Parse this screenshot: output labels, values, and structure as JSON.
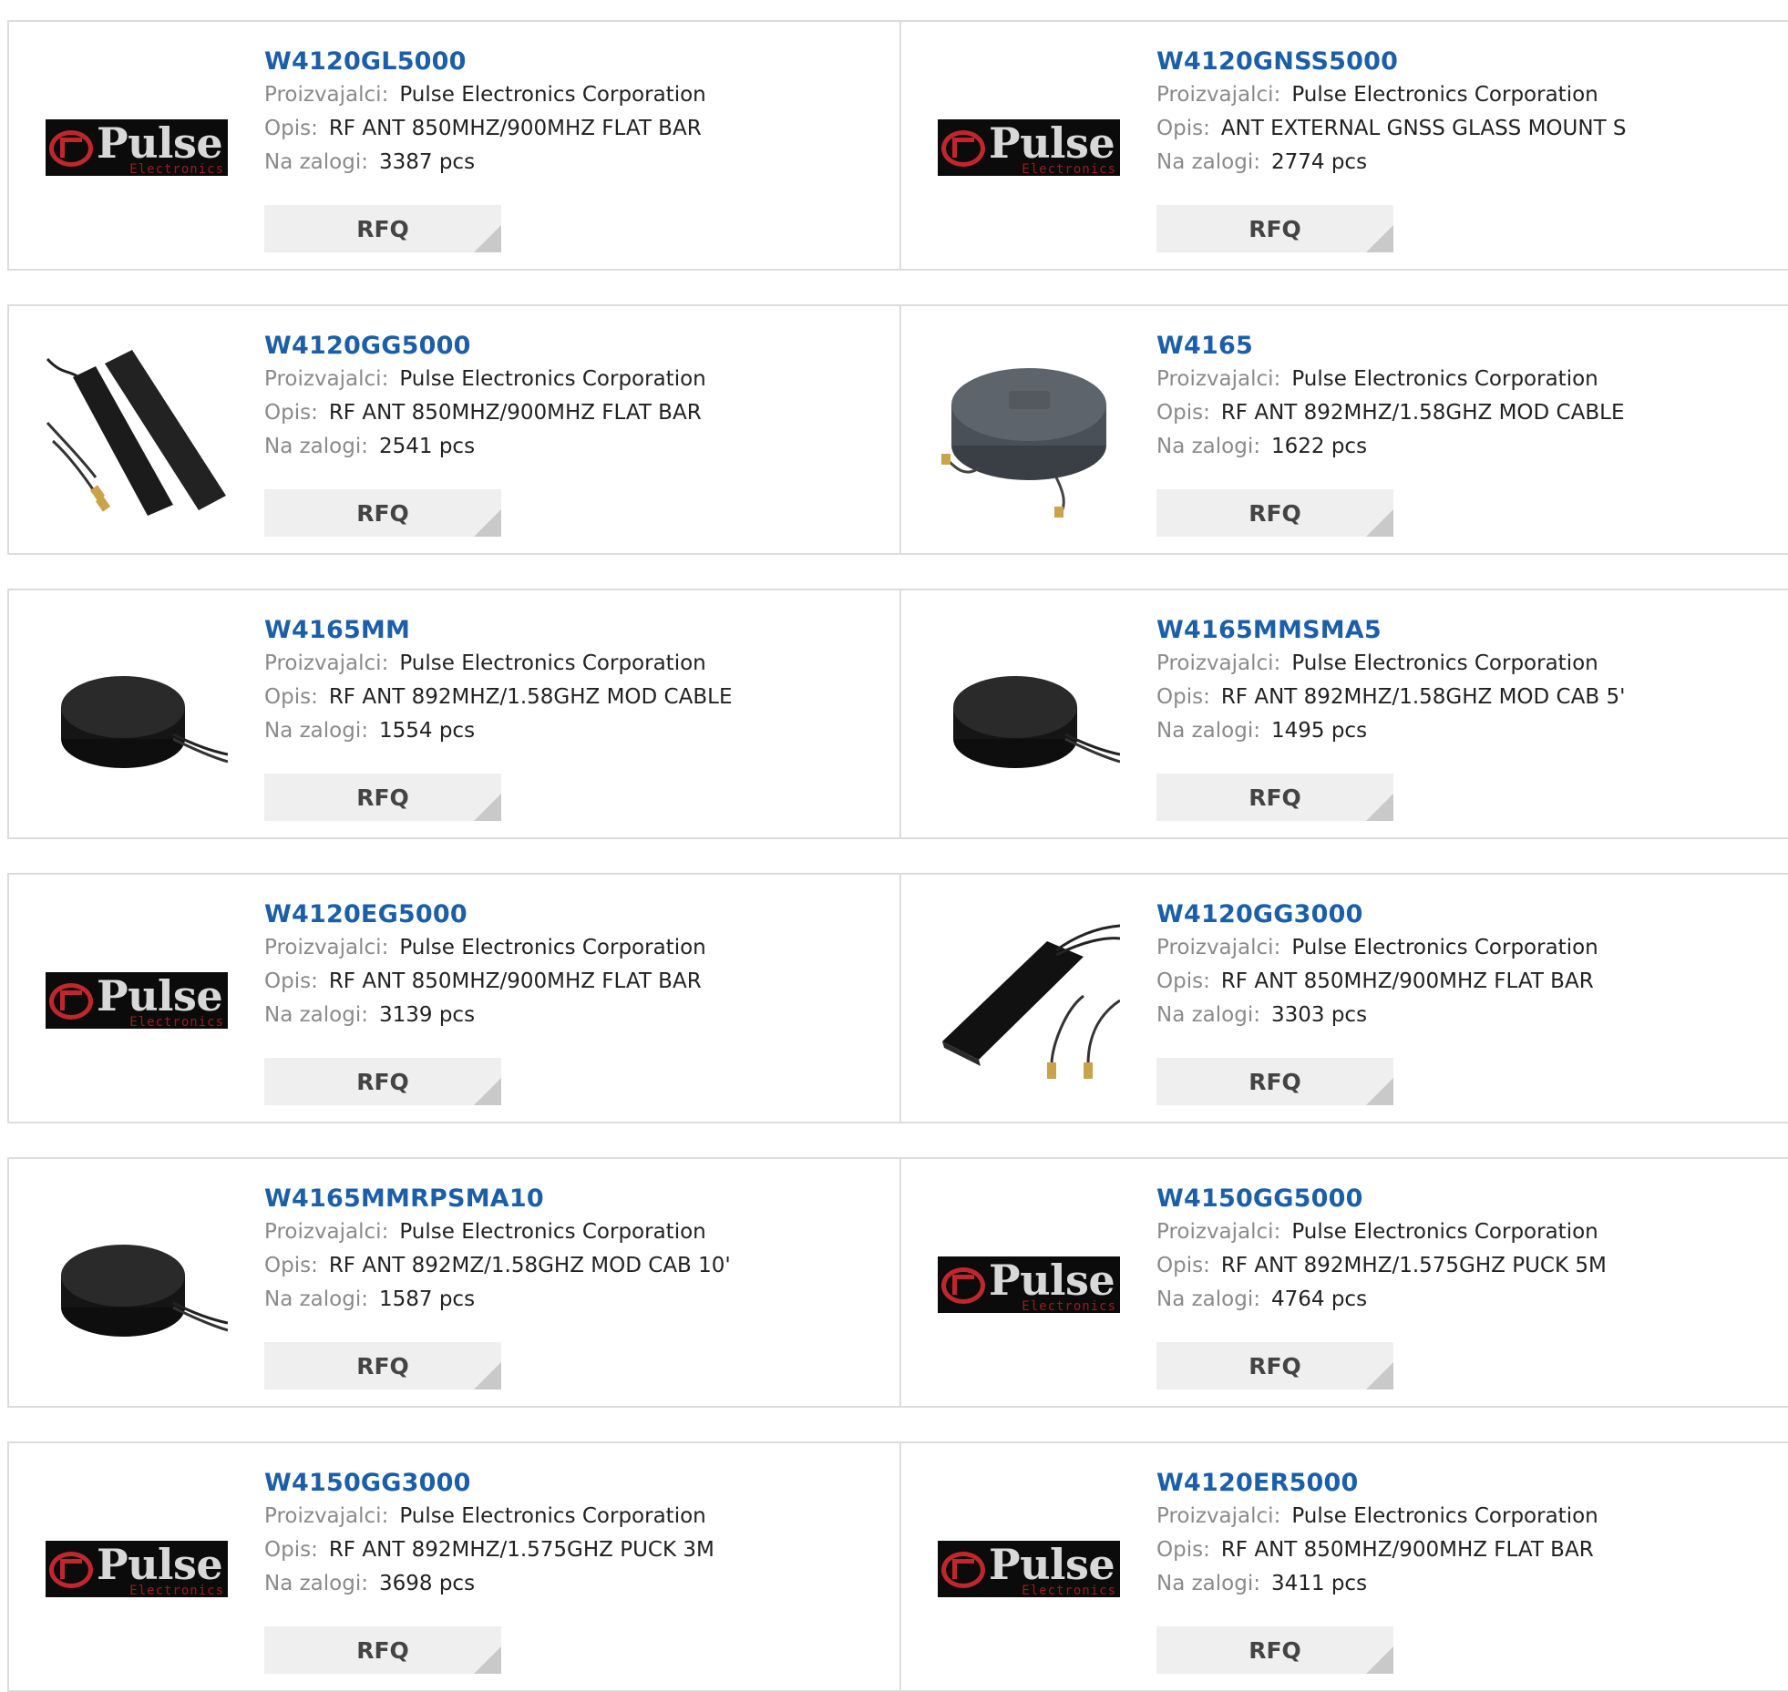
{
  "labels": {
    "manufacturer": "Proizvajalci:",
    "description": "Opis:",
    "stock": "Na zalogi:",
    "rfq": "RFQ",
    "logo_word": "Pulse",
    "logo_sub": "Electronics"
  },
  "products": [
    {
      "part": "W4120GL5000",
      "manufacturer": "Pulse Electronics Corporation",
      "description": "RF ANT 850MHZ/900MHZ FLAT BAR",
      "stock": "3387 pcs",
      "image": "pulse-logo"
    },
    {
      "part": "W4120GNSS5000",
      "manufacturer": "Pulse Electronics Corporation",
      "description": "ANT EXTERNAL GNSS GLASS MOUNT S",
      "stock": "2774 pcs",
      "image": "pulse-logo"
    },
    {
      "part": "W4120GG5000",
      "manufacturer": "Pulse Electronics Corporation",
      "description": "RF ANT 850MHZ/900MHZ FLAT BAR",
      "stock": "2541 pcs",
      "image": "flat-bar-antenna-pair"
    },
    {
      "part": "W4165",
      "manufacturer": "Pulse Electronics Corporation",
      "description": "RF ANT 892MHZ/1.58GHZ MOD CABLE",
      "stock": "1622 pcs",
      "image": "puck-antenna-grey"
    },
    {
      "part": "W4165MM",
      "manufacturer": "Pulse Electronics Corporation",
      "description": "RF ANT 892MHZ/1.58GHZ MOD CABLE",
      "stock": "1554 pcs",
      "image": "puck-antenna-black"
    },
    {
      "part": "W4165MMSMA5",
      "manufacturer": "Pulse Electronics Corporation",
      "description": "RF ANT 892MHZ/1.58GHZ MOD CAB 5'",
      "stock": "1495 pcs",
      "image": "puck-antenna-black"
    },
    {
      "part": "W4120EG5000",
      "manufacturer": "Pulse Electronics Corporation",
      "description": "RF ANT 850MHZ/900MHZ FLAT BAR",
      "stock": "3139 pcs",
      "image": "pulse-logo"
    },
    {
      "part": "W4120GG3000",
      "manufacturer": "Pulse Electronics Corporation",
      "description": "RF ANT 850MHZ/900MHZ FLAT BAR",
      "stock": "3303 pcs",
      "image": "flat-bar-antenna"
    },
    {
      "part": "W4165MMRPSMA10",
      "manufacturer": "Pulse Electronics Corporation",
      "description": "RF ANT 892MZ/1.58GHZ MOD CAB 10'",
      "stock": "1587 pcs",
      "image": "puck-antenna-black"
    },
    {
      "part": "W4150GG5000",
      "manufacturer": "Pulse Electronics Corporation",
      "description": "RF ANT 892MHZ/1.575GHZ PUCK 5M",
      "stock": "4764 pcs",
      "image": "pulse-logo"
    },
    {
      "part": "W4150GG3000",
      "manufacturer": "Pulse Electronics Corporation",
      "description": "RF ANT 892MHZ/1.575GHZ PUCK 3M",
      "stock": "3698 pcs",
      "image": "pulse-logo"
    },
    {
      "part": "W4120ER5000",
      "manufacturer": "Pulse Electronics Corporation",
      "description": "RF ANT 850MHZ/900MHZ FLAT BAR",
      "stock": "3411 pcs",
      "image": "pulse-logo"
    }
  ]
}
